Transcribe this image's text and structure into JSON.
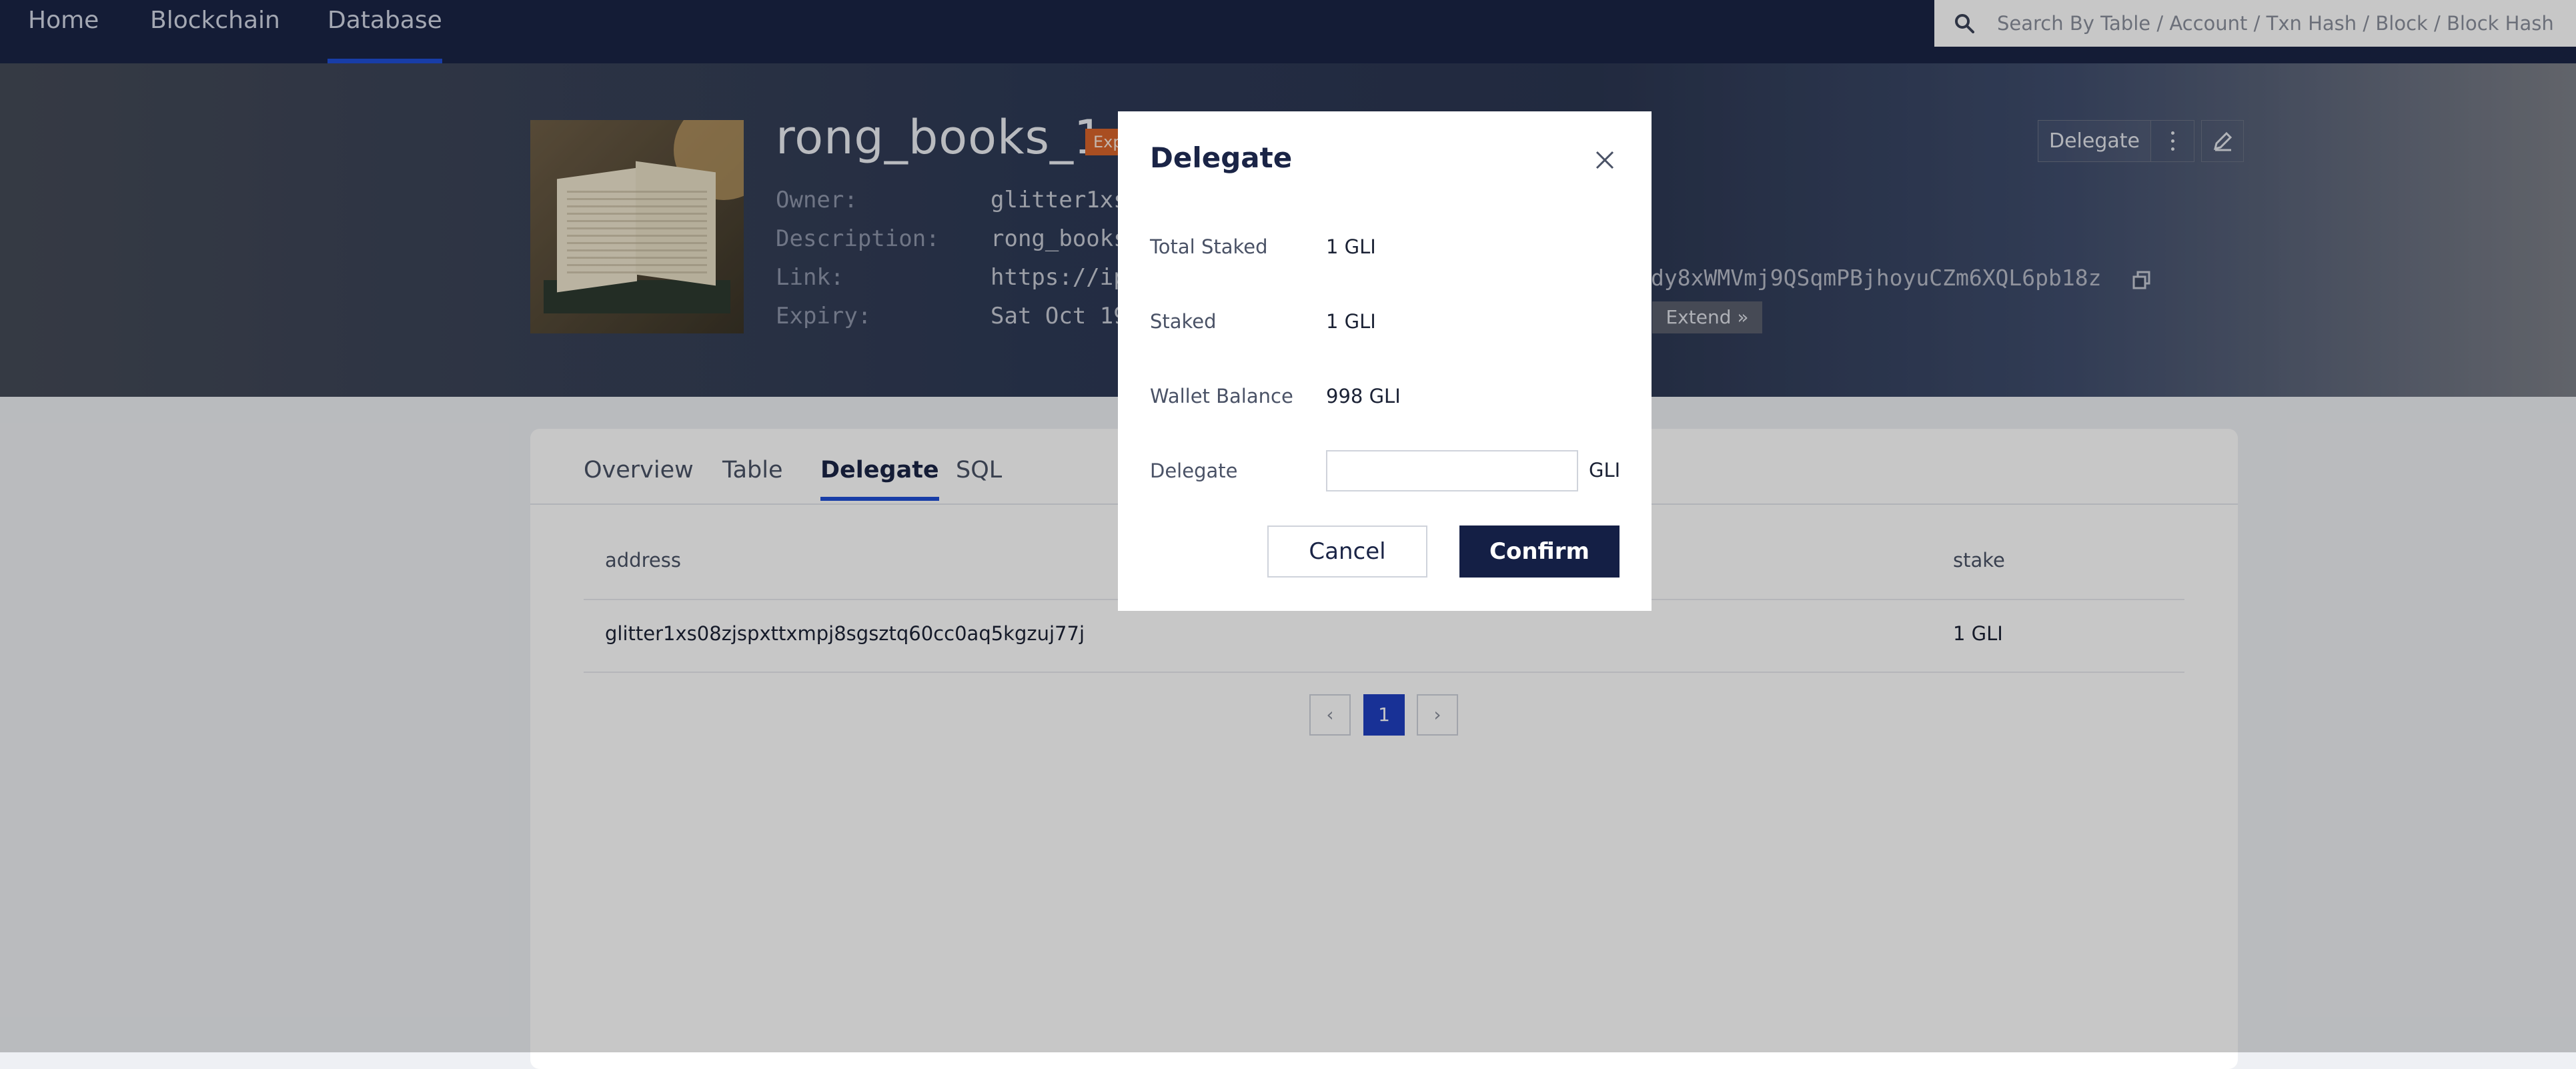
{
  "nav": {
    "items": [
      {
        "label": "Home"
      },
      {
        "label": "Blockchain"
      },
      {
        "label": "Database"
      }
    ],
    "active": "Database",
    "search_placeholder": "Search By Table / Account / Txn Hash / Block / Block Hash"
  },
  "database": {
    "title": "rong_books_1",
    "badge": "Exp",
    "owner_label": "Owner:",
    "owner_value": "glitter1xs",
    "description_label": "Description:",
    "description_value": "rong_books",
    "link_label": "Link:",
    "link_value_start": "https://ip",
    "link_value_end": "dy8xWMVmj9QSqmPBjhoyuCZm6XQL6pb18z",
    "expiry_label": "Expiry:",
    "expiry_value": "Sat Oct 19",
    "extend_label": "Extend »",
    "delegate_button": "Delegate"
  },
  "tabs": [
    {
      "label": "Overview"
    },
    {
      "label": "Table"
    },
    {
      "label": "Delegate"
    },
    {
      "label": "SQL"
    }
  ],
  "active_tab": "Delegate",
  "delegate_table": {
    "columns": [
      "address",
      "stake"
    ],
    "rows": [
      {
        "address": "glitter1xs08zjspxttxmpj8sgsztq60cc0aq5kgzuj77j",
        "stake": "1 GLI"
      }
    ]
  },
  "pagination": {
    "current_page": "1",
    "prev_symbol": "‹",
    "next_symbol": "›"
  },
  "modal": {
    "title": "Delegate",
    "total_staked_label": "Total Staked",
    "total_staked_value": "1 GLI",
    "staked_label": "Staked",
    "staked_value": "1 GLI",
    "wallet_balance_label": "Wallet Balance",
    "wallet_balance_value": "998 GLI",
    "delegate_label": "Delegate",
    "delegate_input_value": "",
    "delegate_unit": "GLI",
    "cancel_label": "Cancel",
    "confirm_label": "Confirm"
  },
  "colors": {
    "nav_bg": "#1a2446",
    "accent": "#1f4fd6",
    "badge": "#d9652b",
    "confirm_bg": "#141f45"
  }
}
